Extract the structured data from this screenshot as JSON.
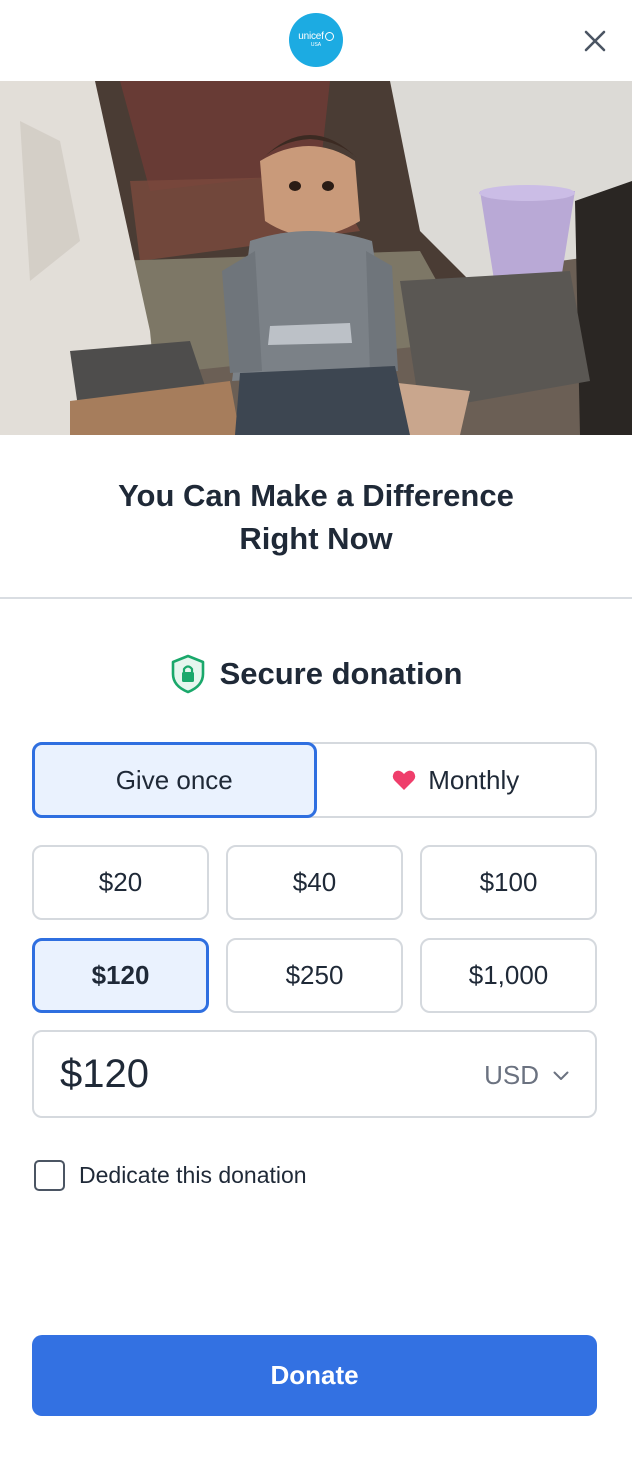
{
  "header": {
    "logo_text": "unicef",
    "logo_sub": "USA",
    "close_icon": "close-icon",
    "logo_color": "#1cabe2"
  },
  "hero": {
    "image": "photo-child-sitting-in-tent"
  },
  "headline": {
    "line1": "You Can Make a Difference",
    "line2": "Right Now"
  },
  "secure": {
    "label": "Secure donation",
    "icon": "shield-lock-icon",
    "icon_color": "#1aa86b"
  },
  "frequency": {
    "options": [
      {
        "label": "Give once",
        "selected": true
      },
      {
        "label": "Monthly",
        "selected": false,
        "icon": "heart-icon"
      }
    ]
  },
  "amounts": [
    {
      "label": "$20",
      "selected": false
    },
    {
      "label": "$40",
      "selected": false
    },
    {
      "label": "$100",
      "selected": false
    },
    {
      "label": "$120",
      "selected": true
    },
    {
      "label": "$250",
      "selected": false
    },
    {
      "label": "$1,000",
      "selected": false
    }
  ],
  "amount_field": {
    "value": "$120",
    "currency": "USD"
  },
  "dedicate": {
    "label": "Dedicate this donation",
    "checked": false
  },
  "donate_button": {
    "label": "Donate",
    "color": "#3371e2"
  },
  "accent_color": "#2f6fe0"
}
